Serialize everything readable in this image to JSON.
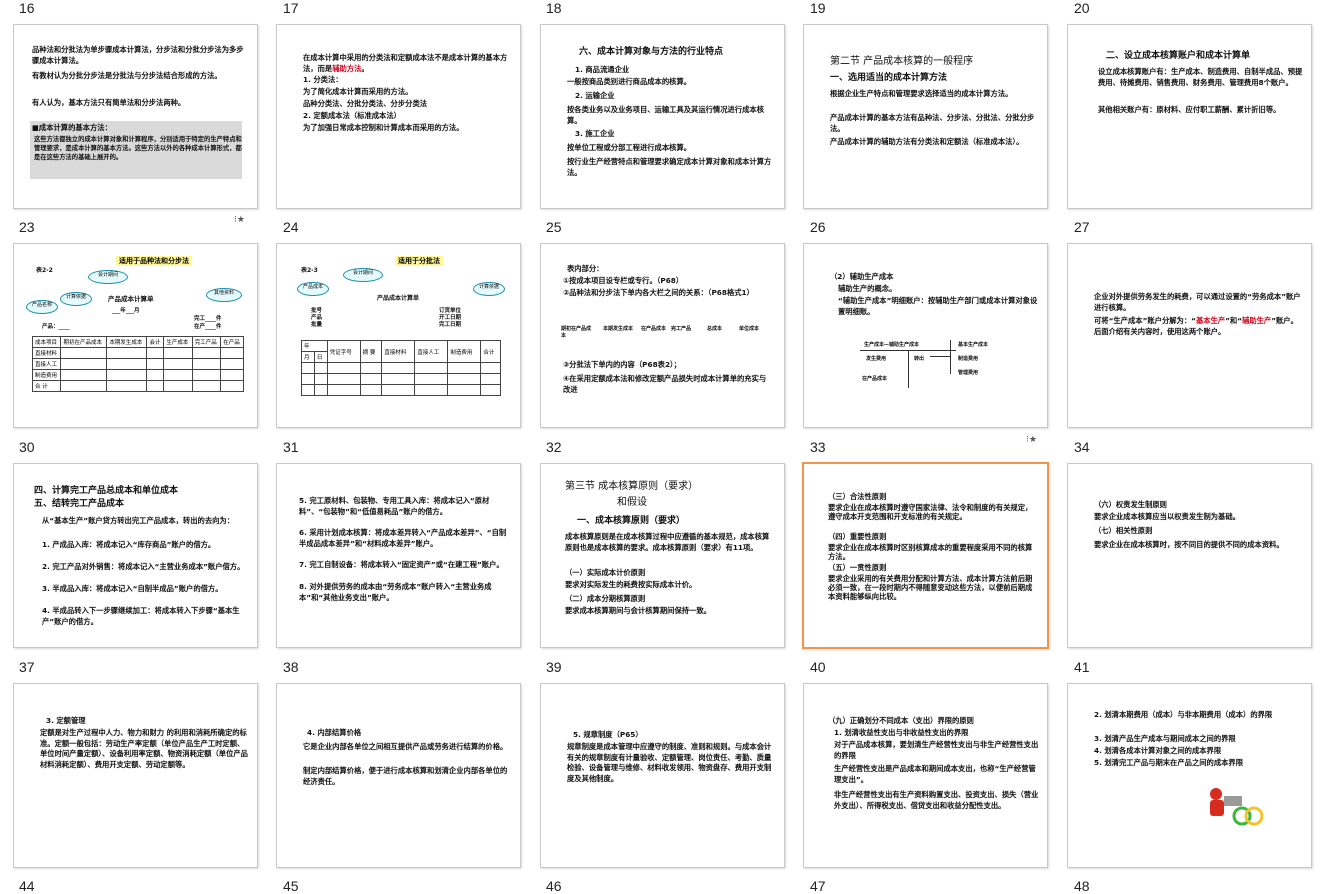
{
  "slides": [
    {
      "num": "16",
      "lines": [
        "品种法和分批法为单步骤成本计算法，分步法和分批分步法为多步骤成本计算法。",
        "有教材认为分批分步法是分批法与分步法结合形成的方法。",
        "有人认为，基本方法只有简单法和分步法两种。",
        "■成本计算的基本方法：",
        "这些方法都独立的成本计算对象和计算程序，分别适用于特定的生产特点和管理要求，是成本计算的基本方法。这些方法以外的各种成本计算形式，都是在这些方法的基础上展开的。"
      ]
    },
    {
      "num": "17",
      "lines": [
        "在成本计算中采用的分类法和定额成本法不是成本计算的基本方法，而是",
        "辅助方法",
        "。",
        "1. 分类法：",
        "为了简化成本计算而采用的方法。",
        "品种分类法、分批分类法、分步分类法",
        "2. 定额成本法（标准成本法）",
        "为了加强日常成本控制和计算成本而采用的方法。"
      ]
    },
    {
      "num": "18",
      "lines": [
        "六、成本计算对象与方法的行业特点",
        "1. 商品流通企业",
        "一般按商品类别进行商品成本的核算。",
        "2. 运输企业",
        "按各类业务以及业务项目、运输工具及其运行情况进行成本核算。",
        "3. 施工企业",
        "按单位工程或分部工程进行成本核算。",
        "按行业生产经营特点和管理要求确定成本计算对象和成本计算方法。"
      ]
    },
    {
      "num": "19",
      "lines": [
        "第二节 产品成本核算的一般程序",
        "一、选用适当的成本计算方法",
        "根据企业生产特点和管理要求选择适当的成本计算方法。",
        "产品成本计算的基本方法有品种法、分步法、分批法、分批分步法。",
        "产品成本计算的辅助方法有分类法和定额法（标准成本法）。"
      ]
    },
    {
      "num": "20",
      "lines": [
        "二、设立成本核算账户和成本计算单",
        "设立成本核算账户有：生产成本、制造费用、自制半成品、预提费用、待摊费用、销售费用、财务费用、管理费用8个账户。",
        "其他相关账户有：原材料、应付职工薪酬、累计折旧等。"
      ]
    },
    {
      "num": "23",
      "lines": [
        "适用于品种法和分步法",
        "表2-2",
        "产品成本计算单",
        "会计期间",
        "计算依据",
        "产品名称",
        "其他资料",
        "___年___月",
        "完工____件",
        "在产____件",
        "产品：____",
        "成本项目",
        "期初在产品成本",
        "本期发生成本",
        "会计",
        "生产成本",
        "完工产品",
        "在产品",
        "直接材料",
        "直接人工",
        "制造费用",
        "合 计"
      ]
    },
    {
      "num": "24",
      "lines": [
        "适用于分批法",
        "表2-3",
        "产品成本",
        "会计期间",
        "计算依据",
        "产品成本计算单",
        "批号",
        "产品",
        "批量",
        "订货单位",
        "开工日期",
        "完工日期",
        "年",
        "月",
        "日",
        "凭证字号",
        "摘 要",
        "直接材料",
        "直接人工",
        "制造费用",
        "合计"
      ]
    },
    {
      "num": "25",
      "lines": [
        "表内部分：",
        "①按成本项目设专栏或专行。（P68）",
        "②品种法和分步法下单内各大栏之间的关系：（P68格式1）",
        "期初在产品成本",
        "本期发生成本",
        "在产品成本",
        "完工产品",
        "总成本",
        "单位成本",
        "③分批法下单内的内容（P68表2）；",
        "④在采用定额成本法和修改定额产品损失时成本计算单的充实与改进"
      ]
    },
    {
      "num": "26",
      "lines": [
        "（2）辅助生产成本",
        "辅助生产的概念。",
        "“辅助生产成本”明细账户：按辅助生产部门或成本计算对象设置明细账。",
        "生产成本—辅助生产成本",
        "发生费用",
        "转出",
        "在产品成本",
        "基本生产成本",
        "制造费用",
        "管理费用"
      ]
    },
    {
      "num": "27",
      "lines": [
        "企业对外提供劳务发生的耗费，可以通过设置的“劳务成本”账户进行核算。",
        "可将“生产成本”账户分解为：“",
        "基本生产",
        "”和“",
        "辅助生产",
        "”账户。后面介绍有关内容时，使用这两个账户。"
      ]
    },
    {
      "num": "30",
      "lines": [
        "四、计算完工产品总成本和单位成本",
        "五、结转完工产品成本",
        "从“基本生产”账户贷方转出完工产品成本，转出的去向为：",
        "1. 产成品入库：将成本记入“库存商品”账户的借方。",
        "2. 完工产品对外销售：将成本记入“主营业务成本”账户借方。",
        "3. 半成品入库：将成本记入“自制半成品”账户的借方。",
        "4. 半成品转入下一步骤继续加工：将成本转入下步骤“基本生产”账户的借方。"
      ]
    },
    {
      "num": "31",
      "lines": [
        "5. 完工原材料、包装物、专用工具入库：将成本记入“原材料”、“包装物”和“低值易耗品”账户的借方。",
        "6. 采用计划成本核算：将成本差异转入“产品成本差异”、“自制半成品成本差异”和“材料成本差异”账户。",
        "7. 完工自制设备：将成本转入“固定资产”或“在建工程”账户。",
        "8. 对外提供劳务的成本由“劳务成本”账户转入“主营业务成本”和“其他业务支出”账户。"
      ]
    },
    {
      "num": "32",
      "lines": [
        "第三节 成本核算原则（要求）",
        "和假设",
        "一、成本核算原则（要求）",
        "成本核算原则是在成本核算过程中应遵循的基本规范，成本核算原则也是成本核算的要求。成本核算原则（要求）有11项。",
        "（一）实际成本计价原则",
        "要求对实际发生的耗费按实际成本计价。",
        "（二）成本分期核算原则",
        "要求成本核算期间与会计核算期间保持一致。"
      ]
    },
    {
      "num": "33",
      "lines": [
        "（三）合法性原则",
        "要求企业在成本核算时遵守国家法律、法令和制度的有关规定，遵守成本开支范围和开支标准的有关规定。",
        "（四）重要性原则",
        "要求企业在成本核算时区别核算成本的重要程度采用不同的核算方法。",
        "（五）一贯性原则",
        "要求企业采用的有关费用分配和计算方法、成本计算方法前后期必须一致，在一段时期内不得随意变动这些方法，以便前后期成本资料能够纵向比较。"
      ]
    },
    {
      "num": "34",
      "lines": [
        "（六）权责发生制原则",
        "要求企业成本核算应当以权责发生制为基础。",
        "（七）相关性原则",
        "要求企业在成本核算时，按不同目的提供不同的成本资料。"
      ]
    },
    {
      "num": "37",
      "lines": [
        "3. 定额管理",
        "定额是对生产过程中人力、物力和财力 的利用和消耗所确定的标准。定额一般包括：劳动生产率定额（单位产品生产工时定额、单位时间产量定额）、设备利用率定额、物资消耗定额（单位产品材料消耗定额）、费用开支定额、劳动定额等。"
      ]
    },
    {
      "num": "38",
      "lines": [
        "4. 内部结算价格",
        "它是企业内部各单位之间相互提供产品或劳务进行结算的价格。",
        "制定内部结算价格，便于进行成本核算和划清企业内部各单位的经济责任。"
      ]
    },
    {
      "num": "39",
      "lines": [
        "5. 规章制度（P65）",
        "规章制度是成本管理中应遵守的制度、准则和规则。与成本会计有关的规章制度有计量验收、定额管理、岗位责任、考勤、质量检验、设备管理与维修、材料收发领用、物资盘存、费用开支制度及其他制度。"
      ]
    },
    {
      "num": "40",
      "lines": [
        "（九）正确划分不同成本（支出）界限的原则",
        "1. 划清收益性支出与非收益性支出的界限",
        "对于产品成本核算，要划清生产经营性支出与非生产经营性支出的界限",
        "生产经营性支出是产品成本和期间成本支出，也称“生产经营管理支出”。",
        "非生产经营性支出有生产资料购置支出、投资支出、损失（营业外支出）、所得税支出、借贷支出和收益分配性支出。"
      ]
    },
    {
      "num": "41",
      "lines": [
        "2. 划清本期费用（成本）与非本期费用（成本）的界限",
        "3. 划清产品生产成本与期间成本之间的界限",
        "4. 划清各成本计算对象之间的成本界限",
        "5. 划清完工产品与期末在产品之间的成本界限"
      ]
    }
  ],
  "bottom_row_nums": [
    "44",
    "45",
    "46",
    "47",
    "48"
  ],
  "colors": {
    "selection": "#f0964a",
    "red": "#d0021b",
    "magenta": "#cc1d9e",
    "blue": "#1f4f9e"
  }
}
